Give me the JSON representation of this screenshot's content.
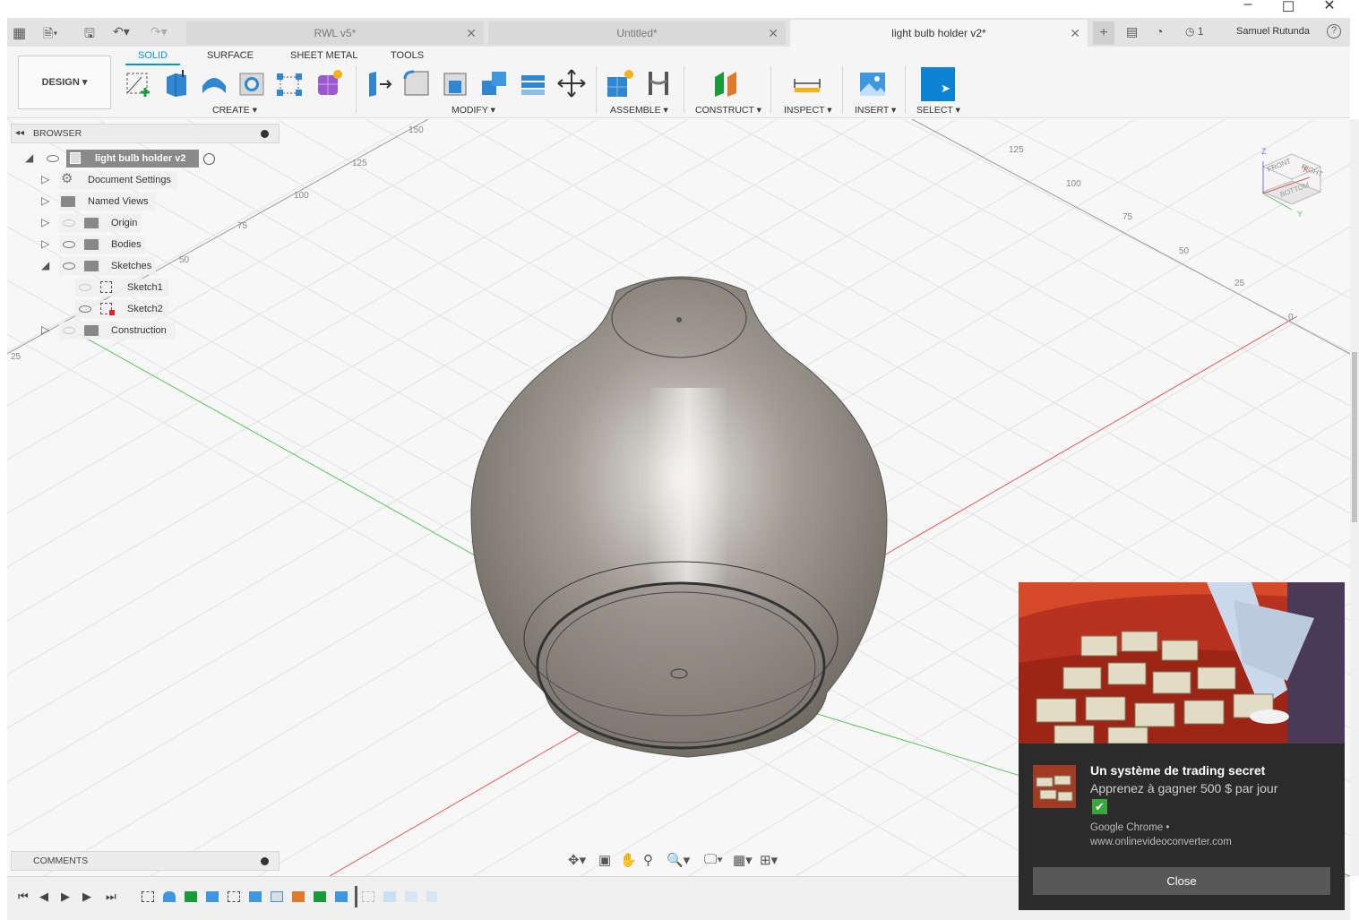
{
  "tabs": [
    {
      "label": "RWL v5*",
      "active": false
    },
    {
      "label": "Untitled*",
      "active": false
    },
    {
      "label": "light bulb holder v2*",
      "active": true
    }
  ],
  "header_right": {
    "job_count": "1",
    "user_name": "Samuel Rutunda"
  },
  "workspace": {
    "label": "DESIGN"
  },
  "ribbon_tabs": [
    "SOLID",
    "SURFACE",
    "SHEET METAL",
    "TOOLS"
  ],
  "ribbon_groups": [
    "CREATE",
    "MODIFY",
    "ASSEMBLE",
    "CONSTRUCT",
    "INSPECT",
    "INSERT",
    "SELECT"
  ],
  "browser": {
    "title": "BROWSER",
    "root": "light bulb holder v2",
    "items": [
      {
        "label": "Document Settings"
      },
      {
        "label": "Named Views"
      },
      {
        "label": "Origin"
      },
      {
        "label": "Bodies"
      },
      {
        "label": "Sketches"
      },
      {
        "label": "Sketch1"
      },
      {
        "label": "Sketch2"
      },
      {
        "label": "Construction"
      }
    ]
  },
  "comments": {
    "title": "COMMENTS"
  },
  "grid_labels": [
    "150",
    "125",
    "100",
    "75",
    "50",
    "25",
    "125",
    "100",
    "75",
    "50",
    "25",
    "0",
    "25"
  ],
  "viewcube": {
    "front": "FRONT",
    "right": "RIGHT",
    "bottom": "BOTTOM",
    "z": "Z",
    "x": "X",
    "y": "Y"
  },
  "notification": {
    "title": "Un système de trading secret",
    "body": "Apprenez à gagner 500 $ par jour",
    "source_line1": "Google Chrome •",
    "source_line2": "www.onlinevideoconverter.com",
    "close_label": "Close"
  },
  "colors": {
    "accent": "#0696d7",
    "select_blue": "#0a84d0",
    "body_gray": "#8a857d"
  }
}
